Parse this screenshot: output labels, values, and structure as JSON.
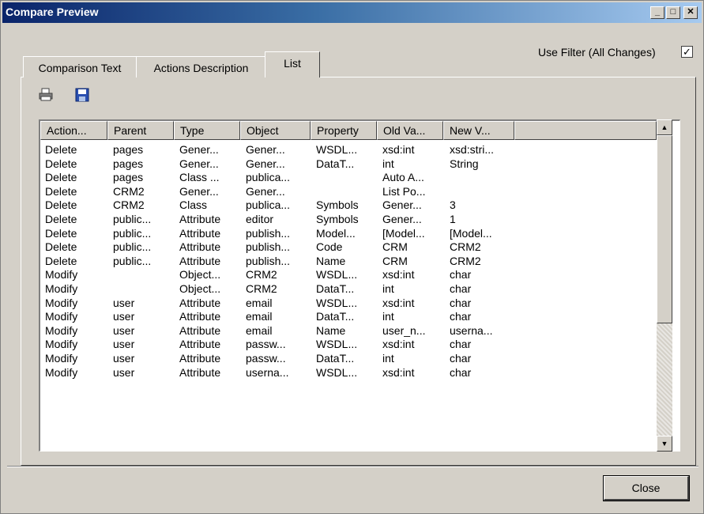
{
  "window": {
    "title": "Compare Preview"
  },
  "controls": {
    "minimize": "_",
    "maximize": "□",
    "close": "✕"
  },
  "filter": {
    "label": "Use Filter (All Changes)",
    "checked": true,
    "check_glyph": "✓"
  },
  "tabs": [
    {
      "label": "Comparison Text",
      "active": false
    },
    {
      "label": "Actions Description",
      "active": false
    },
    {
      "label": "List",
      "active": true
    }
  ],
  "toolbar": {
    "icons": [
      "printer-icon",
      "floppy-save-icon"
    ]
  },
  "table": {
    "columns": [
      "Action...",
      "Parent",
      "Type",
      "Object",
      "Property",
      "Old Va...",
      "New V..."
    ],
    "rows": [
      [
        "Delete",
        "pages",
        "Gener...",
        "Gener...",
        "WSDL...",
        "xsd:int",
        "xsd:stri..."
      ],
      [
        "Delete",
        "pages",
        "Gener...",
        "Gener...",
        "DataT...",
        "int",
        "String"
      ],
      [
        "Delete",
        "pages",
        "Class ...",
        "publica...",
        "",
        "Auto A...",
        ""
      ],
      [
        "Delete",
        "CRM2",
        "Gener...",
        "Gener...",
        "",
        "List Po...",
        ""
      ],
      [
        "Delete",
        "CRM2",
        "Class",
        "publica...",
        "Symbols",
        "Gener...",
        "3"
      ],
      [
        "Delete",
        "public...",
        "Attribute",
        "editor",
        "Symbols",
        "Gener...",
        "1"
      ],
      [
        "Delete",
        "public...",
        "Attribute",
        "publish...",
        "Model...",
        "[Model...",
        "[Model..."
      ],
      [
        "Delete",
        "public...",
        "Attribute",
        "publish...",
        "Code",
        "CRM",
        "CRM2"
      ],
      [
        "Delete",
        "public...",
        "Attribute",
        "publish...",
        "Name",
        "CRM",
        "CRM2"
      ],
      [
        "Modify",
        "",
        "Object...",
        "CRM2",
        "WSDL...",
        "xsd:int",
        "char"
      ],
      [
        "Modify",
        "",
        "Object...",
        "CRM2",
        "DataT...",
        "int",
        "char"
      ],
      [
        "Modify",
        "user",
        "Attribute",
        "email",
        "WSDL...",
        "xsd:int",
        "char"
      ],
      [
        "Modify",
        "user",
        "Attribute",
        "email",
        "DataT...",
        "int",
        "char"
      ],
      [
        "Modify",
        "user",
        "Attribute",
        "email",
        "Name",
        "user_n...",
        "userna..."
      ],
      [
        "Modify",
        "user",
        "Attribute",
        "passw...",
        "WSDL...",
        "xsd:int",
        "char"
      ],
      [
        "Modify",
        "user",
        "Attribute",
        "passw...",
        "DataT...",
        "int",
        "char"
      ],
      [
        "Modify",
        "user",
        "Attribute",
        "userna...",
        "WSDL...",
        "xsd:int",
        "char"
      ]
    ]
  },
  "scrollbar": {
    "up": "▲",
    "down": "▼",
    "position": 0
  },
  "buttons": {
    "close": "Close"
  },
  "colors": {
    "face": "#d4d0c8",
    "title_start": "#0a246a",
    "title_end": "#a6caf0"
  }
}
